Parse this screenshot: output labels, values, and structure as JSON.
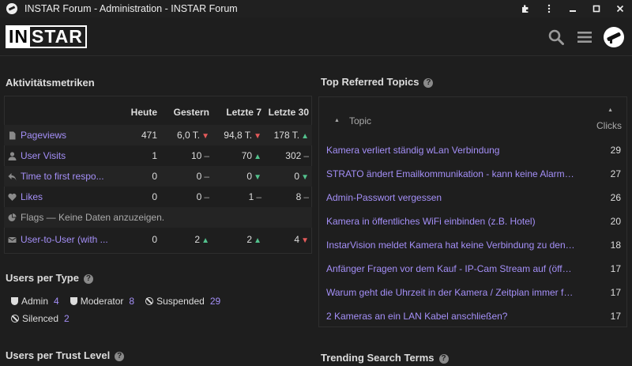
{
  "window": {
    "title": "INSTAR Forum - Administration - INSTAR Forum"
  },
  "header": {
    "logo_part1": "IN",
    "logo_part2": "STAR"
  },
  "activity": {
    "title": "Aktivitätsmetriken",
    "columns": [
      "Heute",
      "Gestern",
      "Letzte 7",
      "Letzte 30"
    ],
    "rows": [
      {
        "label": "Pageviews",
        "icon": "file-icon",
        "today": "471",
        "yesterday": "6,0 T.",
        "y_trend": "down",
        "last7": "94,8 T.",
        "l7_trend": "down",
        "last30": "178 T.",
        "l30_trend": "up"
      },
      {
        "label": "User Visits",
        "icon": "user-icon",
        "today": "1",
        "yesterday": "10",
        "y_trend": "flat",
        "last7": "70",
        "l7_trend": "up",
        "last30": "302",
        "l30_trend": "flat"
      },
      {
        "label": "Time to first respo...",
        "icon": "reply-icon",
        "today": "0",
        "yesterday": "0",
        "y_trend": "flat",
        "last7": "0",
        "l7_trend": "down-green",
        "last30": "0",
        "l30_trend": "down-green"
      },
      {
        "label": "Likes",
        "icon": "heart-icon",
        "today": "0",
        "yesterday": "0",
        "y_trend": "flat",
        "last7": "1",
        "l7_trend": "flat",
        "last30": "8",
        "l30_trend": "flat"
      },
      {
        "label": "Flags — Keine Daten anzuzeigen.",
        "icon": "flag-chart-icon",
        "nodata": true
      },
      {
        "label": "User-to-User (with ...",
        "icon": "envelope-icon",
        "today": "0",
        "yesterday": "2",
        "y_trend": "up",
        "last7": "2",
        "l7_trend": "up",
        "last30": "4",
        "l30_trend": "down"
      }
    ]
  },
  "users_per_type": {
    "title": "Users per Type",
    "items": [
      {
        "label": "Admin",
        "count": "4"
      },
      {
        "label": "Moderator",
        "count": "8"
      },
      {
        "label": "Suspended",
        "count": "29"
      },
      {
        "label": "Silenced",
        "count": "2"
      }
    ]
  },
  "users_per_trust": {
    "title": "Users per Trust Level"
  },
  "top_referred": {
    "title": "Top Referred Topics",
    "col_topic": "Topic",
    "col_clicks": "Clicks",
    "rows": [
      {
        "topic": "Kamera verliert ständig wLan Verbindung",
        "clicks": "29"
      },
      {
        "topic": "STRATO ändert Emailkommunikation - kann keine Alarmemails mehr senden",
        "clicks": "27"
      },
      {
        "topic": "Admin-Passwort vergessen",
        "clicks": "26"
      },
      {
        "topic": "Kamera in öffentliches WiFi einbinden (z.B. Hotel)",
        "clicks": "20"
      },
      {
        "topic": "InstarVision meldet Kamera hat keine Verbindung zu den Servern",
        "clicks": "18"
      },
      {
        "topic": "Anfänger Fragen vor dem Kauf - IP-Cam Stream auf (öffentliche) Webseite",
        "clicks": "17"
      },
      {
        "topic": "Warum geht die Uhrzeit in der Kamera / Zeitplan immer falsch",
        "clicks": "17"
      },
      {
        "topic": "2 Kameras an ein LAN Kabel anschließen?",
        "clicks": "17"
      }
    ]
  },
  "trending": {
    "title": "Trending Search Terms"
  },
  "colors": {
    "accent": "#a48ff7",
    "up": "#53c28d",
    "down": "#e45a5a",
    "background": "#1e1e1e"
  }
}
